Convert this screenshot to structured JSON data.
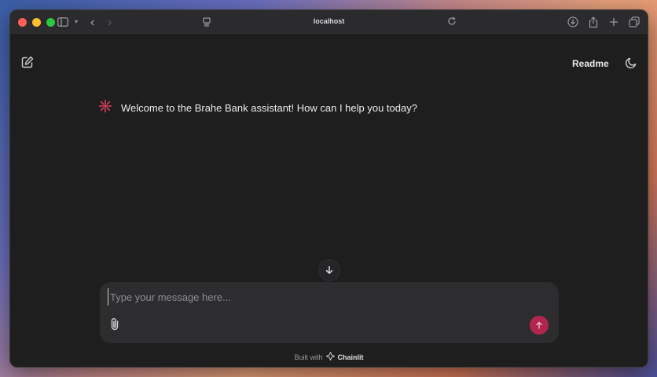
{
  "browser": {
    "address": "localhost"
  },
  "header": {
    "readme_label": "Readme"
  },
  "messages": [
    {
      "text": "Welcome to the Brahe Bank assistant! How can I help you today?"
    }
  ],
  "composer": {
    "placeholder": "Type your message here...",
    "value": ""
  },
  "footer": {
    "built_with": "Built with",
    "brand": "Chainlit"
  },
  "colors": {
    "send_button": "#b0264e",
    "logo": "#e0405f",
    "background": "#1e1e1f"
  }
}
